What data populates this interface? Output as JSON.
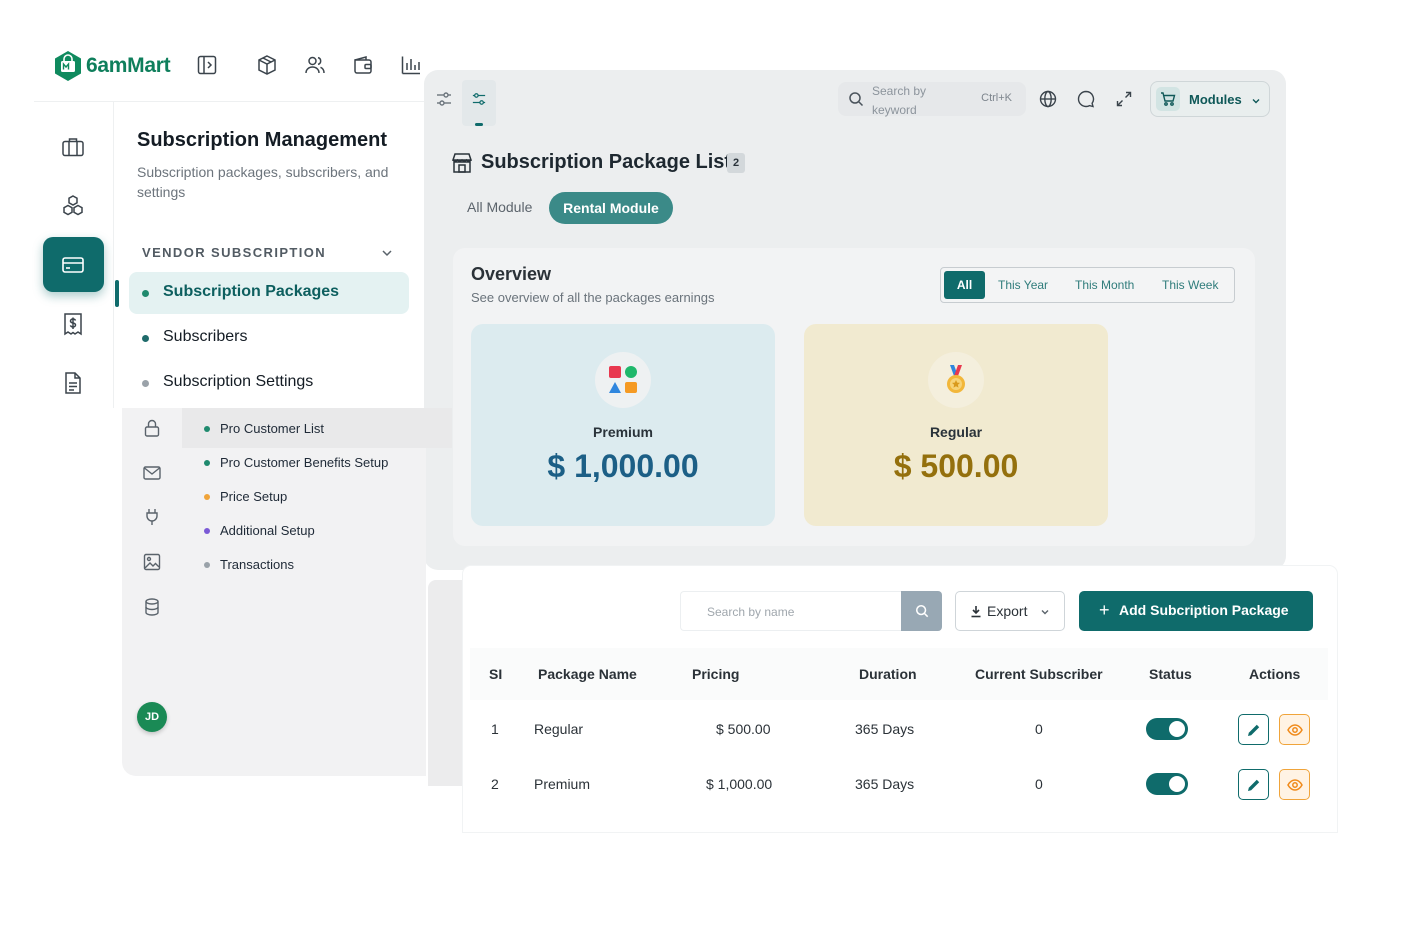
{
  "brand": {
    "name": "6amMart",
    "color": "#0f7f5c"
  },
  "accent_color": "#0f6b6b",
  "top_icons": [
    "sidebar-toggle-icon",
    "box-icon",
    "users-icon",
    "wallet-icon",
    "bar-chart-icon"
  ],
  "rail_icons": [
    "briefcase-icon",
    "cubes-icon",
    "card-icon",
    "invoice-icon",
    "document-icon"
  ],
  "menu": {
    "title": "Subscription Management",
    "subtitle": "Subscription packages, subscribers, and settings",
    "section": "VENDOR SUBSCRIPTION",
    "items": [
      {
        "label": "Subscription Packages",
        "active": true
      },
      {
        "label": "Subscribers",
        "active": false
      },
      {
        "label": "Subscription Settings",
        "active": false
      }
    ]
  },
  "secondary_menu": {
    "items": [
      {
        "label": "Pro Customer List",
        "dot": "#1f8a6e"
      },
      {
        "label": "Pro Customer Benefits Setup",
        "dot": "#1f8a6e"
      },
      {
        "label": "Price Setup",
        "dot": "#f0a43a"
      },
      {
        "label": "Additional Setup",
        "dot": "#7b5ad6"
      },
      {
        "label": "Transactions",
        "dot": "#9aa2a9"
      }
    ],
    "avatar_initials": "JD"
  },
  "header": {
    "search_placeholder": "Search by keyword",
    "shortcut": "Ctrl+K",
    "modules_label": "Modules"
  },
  "page": {
    "title": "Subscription Package List",
    "count": "2",
    "module_tabs": [
      "All Module",
      "Rental Module"
    ],
    "active_module": "Rental Module"
  },
  "overview": {
    "title": "Overview",
    "subtitle": "See overview of all the packages earnings",
    "filters": [
      "All",
      "This Year",
      "This Month",
      "This Week"
    ],
    "active_filter": "All",
    "cards": [
      {
        "name": "Premium",
        "amount": "$ 1,000.00"
      },
      {
        "name": "Regular",
        "amount": "$ 500.00"
      }
    ]
  },
  "table": {
    "search_placeholder": "Search by name",
    "export_label": "Export",
    "add_label": "Add Subcription Package",
    "columns": [
      "SI",
      "Package Name",
      "Pricing",
      "Duration",
      "Current Subscriber",
      "Status",
      "Actions"
    ],
    "rows": [
      {
        "si": "1",
        "name": "Regular",
        "pricing": "$ 500.00",
        "duration": "365 Days",
        "subscribers": "0",
        "status": true
      },
      {
        "si": "2",
        "name": "Premium",
        "pricing": "$ 1,000.00",
        "duration": "365 Days",
        "subscribers": "0",
        "status": true
      }
    ]
  }
}
